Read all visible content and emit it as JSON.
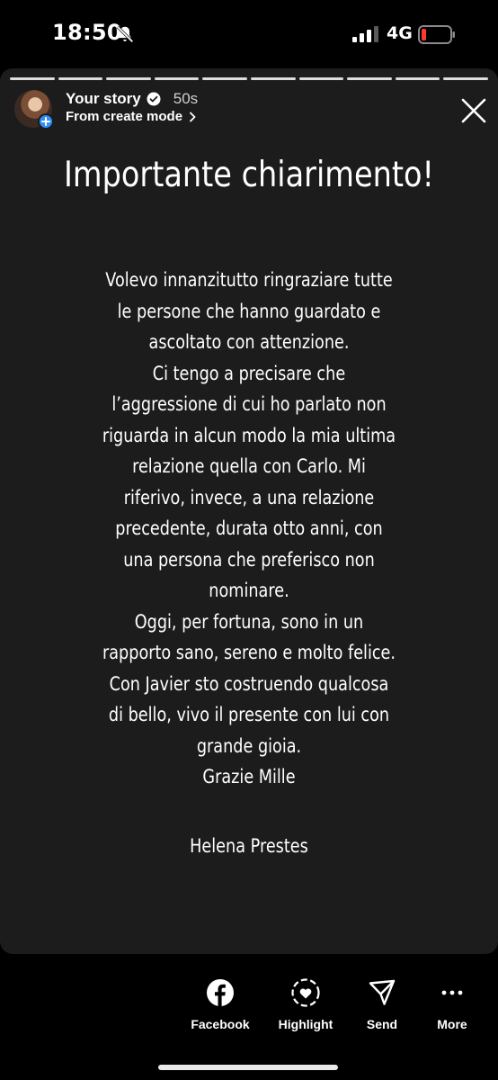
{
  "status_bar": {
    "time": "18:50",
    "network": "4G",
    "icons": [
      "bell-slash-icon",
      "signal-icon",
      "battery-low-icon"
    ]
  },
  "story": {
    "progress_segments": 10,
    "title": "Your story",
    "time_ago": "50s",
    "subtitle": "From create mode",
    "heading": "Importante chiarimento!",
    "body_lines": [
      "Volevo innanzitutto ringraziare tutte",
      "le persone che hanno guardato e",
      "ascoltato con attenzione.",
      "Ci tengo a precisare che",
      "l’aggressione di cui ho parlato non",
      "riguarda in alcun modo la mia ultima",
      "relazione quella con Carlo. Mi",
      "riferivo, invece, a una relazione",
      "precedente, durata otto anni, con",
      "una persona che preferisco non",
      "nominare.",
      "Oggi, per fortuna, sono in un",
      "rapporto sano, sereno e molto felice.",
      "Con Javier sto costruendo qualcosa",
      "di bello, vivo il presente con lui con",
      "grande gioia.",
      "Grazie Mille"
    ],
    "signature": "Helena Prestes"
  },
  "actions": {
    "facebook": "Facebook",
    "highlight": "Highlight",
    "send": "Send",
    "more": "More"
  },
  "colors": {
    "background": "#000000",
    "card": "#1c1c1c",
    "badge_blue": "#2f8ef7",
    "battery_red": "#ff3b30"
  }
}
